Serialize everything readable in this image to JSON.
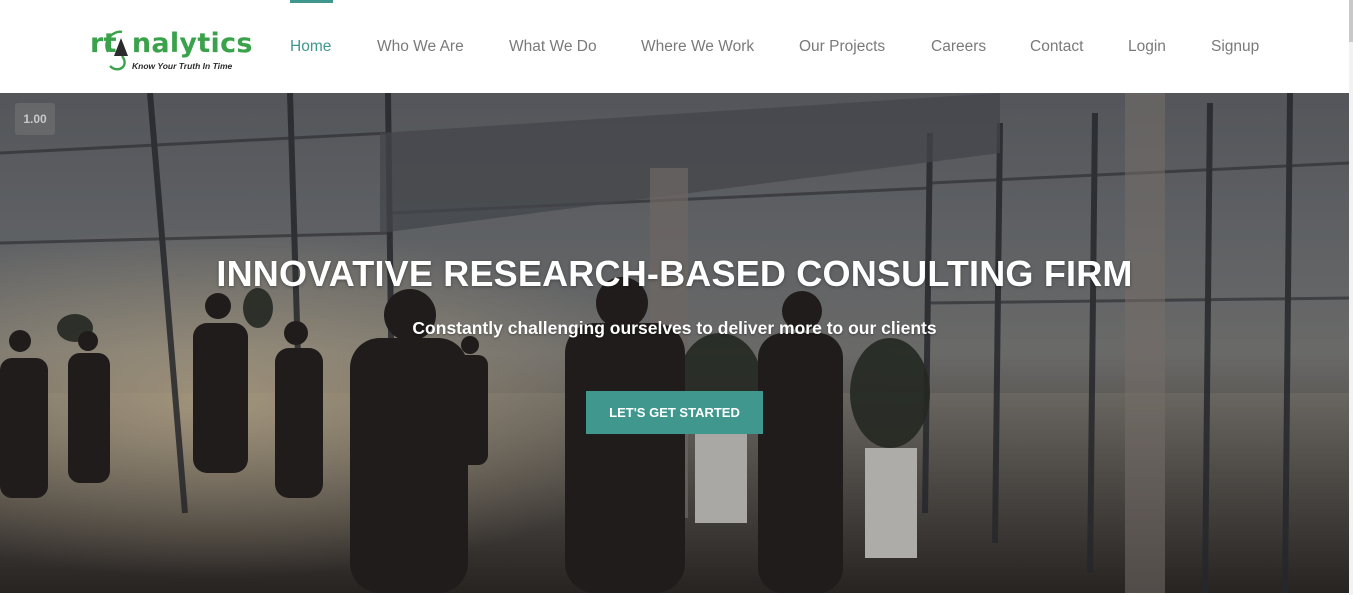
{
  "brand": {
    "name_prefix": "rt",
    "name_suffix": "nalytics",
    "tagline": "Know Your Truth In Time",
    "logo_color": "#3aa24a"
  },
  "nav": {
    "active_color": "#3f978d",
    "items": [
      {
        "label": "Home",
        "active": true
      },
      {
        "label": "Who We Are",
        "active": false
      },
      {
        "label": "What We Do",
        "active": false
      },
      {
        "label": "Where We Work",
        "active": false
      },
      {
        "label": "Our Projects",
        "active": false
      },
      {
        "label": "Careers",
        "active": false
      },
      {
        "label": "Contact",
        "active": false
      },
      {
        "label": "Login",
        "active": false
      },
      {
        "label": "Signup",
        "active": false
      }
    ]
  },
  "hero": {
    "speed_badge": "1.00",
    "title": "INNOVATIVE RESEARCH-BASED CONSULTING FIRM",
    "subtitle": "Constantly challenging ourselves to deliver more to our clients",
    "cta_label": "LET'S GET STARTED",
    "accent_color": "#3f978d"
  }
}
